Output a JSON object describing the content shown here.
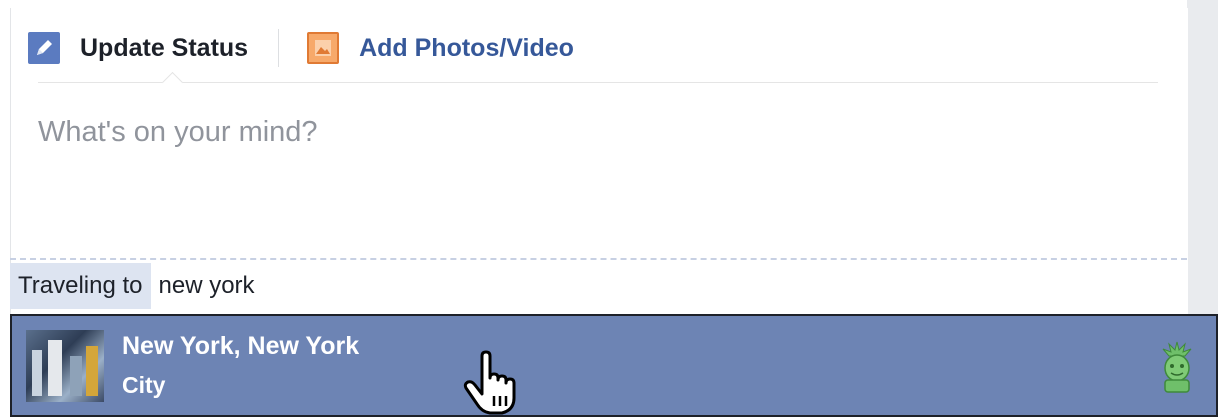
{
  "composer": {
    "tabs": [
      {
        "label": "Update Status",
        "icon": "pencil-icon"
      },
      {
        "label": "Add Photos/Video",
        "icon": "photo-icon"
      }
    ],
    "status_placeholder": "What's on your mind?"
  },
  "travel": {
    "label": "Traveling to",
    "input_value": "new york"
  },
  "suggestion": {
    "title": "New York, New York",
    "subtitle": "City",
    "thumbnail": "new-york-thumbnail",
    "category_icon": "statue-of-liberty-icon"
  },
  "colors": {
    "accent": "#6d84b4",
    "link": "#365899",
    "placeholder": "#90949c"
  }
}
